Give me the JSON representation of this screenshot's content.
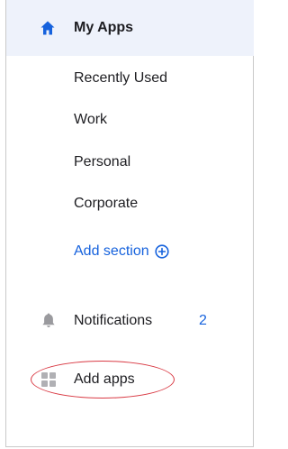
{
  "nav": {
    "active": {
      "label": "My Apps",
      "icon": "home-icon"
    },
    "sections": [
      {
        "label": "Recently Used"
      },
      {
        "label": "Work"
      },
      {
        "label": "Personal"
      },
      {
        "label": "Corporate"
      }
    ],
    "add_section": {
      "label": "Add section",
      "icon": "plus-circle-icon"
    },
    "notifications": {
      "label": "Notifications",
      "count": "2",
      "icon": "bell-icon"
    },
    "add_apps": {
      "label": "Add apps",
      "icon": "grid-icon"
    }
  },
  "colors": {
    "accent": "#1662dd",
    "active_bg": "#eef2fb",
    "highlight": "#d93a44",
    "text": "#1d1d21",
    "icon_gray": "#9a9a9e"
  }
}
